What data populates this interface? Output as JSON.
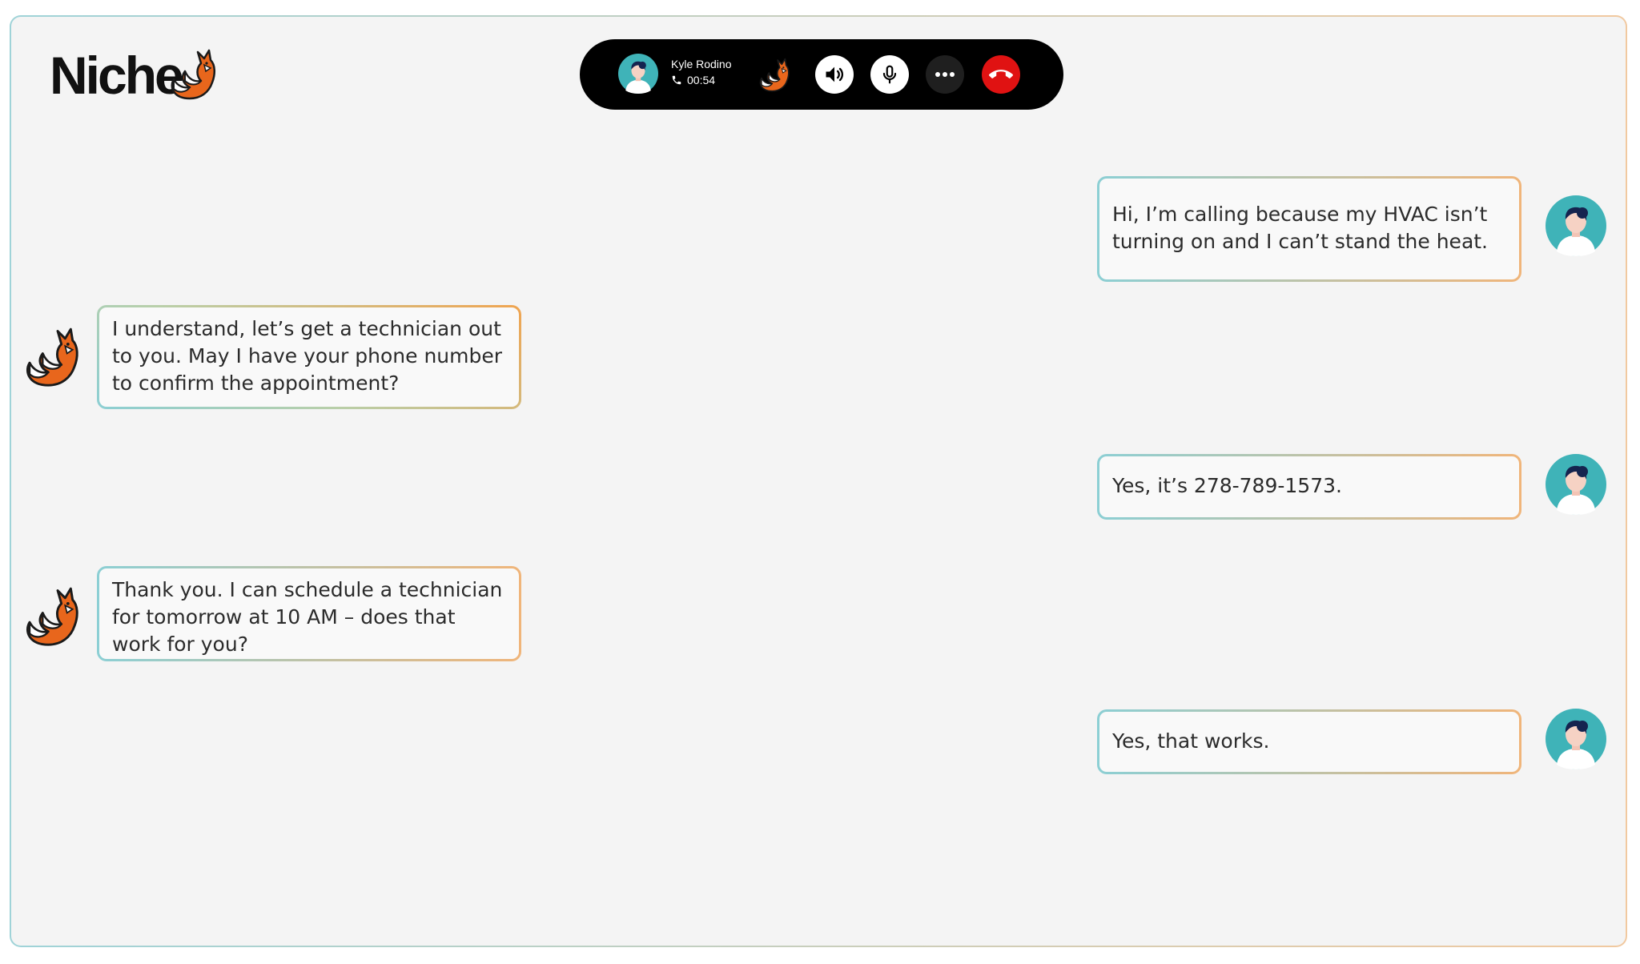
{
  "brand": {
    "logo_text": "Niche"
  },
  "call": {
    "caller_name": "Kyle Rodino",
    "duration": "00:54",
    "icons": {
      "caller_avatar": "user-avatar-icon",
      "phone": "phone-icon",
      "assistant": "fox-icon",
      "speaker": "speaker-icon",
      "mic": "microphone-icon",
      "more": "more-icon",
      "end_call": "hang-up-icon"
    },
    "colors": {
      "bar": "#000000",
      "end_call": "#e01212"
    }
  },
  "messages": [
    {
      "sender": "user",
      "text": "Hi, I’m calling because my HVAC isn’t turning on and I can’t stand the heat."
    },
    {
      "sender": "assistant",
      "text": "I understand, let’s get a technician out to you. May I have your phone number to confirm the appointment?"
    },
    {
      "sender": "user",
      "text": "Yes, it’s 278-789-1573."
    },
    {
      "sender": "assistant",
      "text": "Thank you. I can schedule a technician for tomorrow at 10 AM – does that work for you?"
    },
    {
      "sender": "user",
      "text": "Yes, that works."
    }
  ]
}
